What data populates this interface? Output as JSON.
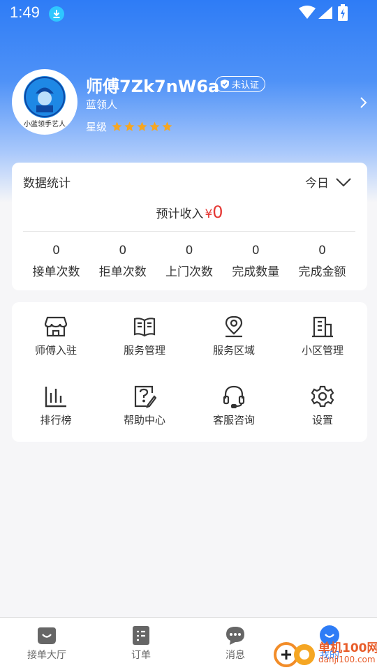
{
  "status_bar": {
    "time": "1:49"
  },
  "profile": {
    "name": "师傅7Zk7nW6a",
    "badge": "未认证",
    "role": "蓝领人",
    "level_label": "星级",
    "stars": 5,
    "avatar_text": "小蓝领手艺人"
  },
  "stats": {
    "title": "数据统计",
    "period": "今日",
    "income_label": "预计收入",
    "currency": "¥",
    "income_value": "0",
    "items": [
      {
        "value": "0",
        "label": "接单次数"
      },
      {
        "value": "0",
        "label": "拒单次数"
      },
      {
        "value": "0",
        "label": "上门次数"
      },
      {
        "value": "0",
        "label": "完成数量"
      },
      {
        "value": "0",
        "label": "完成金额"
      }
    ]
  },
  "menu": [
    {
      "label": "师傅入驻",
      "icon": "store-icon"
    },
    {
      "label": "服务管理",
      "icon": "book-icon"
    },
    {
      "label": "服务区域",
      "icon": "location-icon"
    },
    {
      "label": "小区管理",
      "icon": "building-icon"
    },
    {
      "label": "排行榜",
      "icon": "bar-chart-icon"
    },
    {
      "label": "帮助中心",
      "icon": "help-icon"
    },
    {
      "label": "客服咨询",
      "icon": "headset-icon"
    },
    {
      "label": "设置",
      "icon": "gear-icon"
    }
  ],
  "tabs": [
    {
      "label": "接单大厅",
      "icon": "hall-icon"
    },
    {
      "label": "订单",
      "icon": "order-icon"
    },
    {
      "label": "消息",
      "icon": "message-icon"
    },
    {
      "label": "我的",
      "icon": "profile-icon"
    }
  ],
  "watermark": {
    "text": "单机100网",
    "url": "danji100.com"
  },
  "colors": {
    "accent": "#2e7cf6",
    "star": "#f5a623",
    "money": "#e53935"
  }
}
